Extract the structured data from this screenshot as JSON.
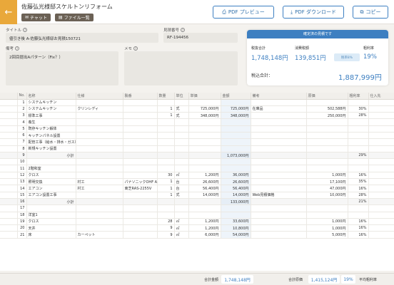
{
  "header": {
    "title": "佐藤弘光様邸スケルトンリフォーム",
    "chat_label": "チャット",
    "files_label": "ファイル一覧",
    "pdf_preview_label": "PDF プレビュー",
    "pdf_download_label": "PDF ダウンロード",
    "copy_label": "コピー"
  },
  "form": {
    "title_label": "タイトル",
    "title_value": "値引き後 A-佐藤弘光様邸お見積150721",
    "estimate_no_label": "見積番号",
    "estimate_no_value": "RF-194456",
    "notes_label": "備考",
    "notes_value": "2回目提出Aパターン（Fix？）",
    "memo_label": "メモ",
    "memo_value": ""
  },
  "summary": {
    "header": "確定済の見積です",
    "subtotal_label": "税抜合計",
    "subtotal_value": "1,748,148円",
    "tax_label": "消費税額",
    "tax_value": "139,851円",
    "tax_rate": "税率8%",
    "margin_label": "粗利率",
    "margin_value": "19%",
    "total_label": "税込合計：",
    "total_value": "1,887,999円"
  },
  "table": {
    "columns": [
      "No.",
      "名称",
      "仕様",
      "製番",
      "数量",
      "単位",
      "単価",
      "金額",
      "備考",
      "原価",
      "粗利率",
      "仕入先"
    ],
    "rows": [
      {
        "no": "1",
        "name": "システムキッチン",
        "spec": "",
        "model": "",
        "qty": "",
        "unit": "",
        "price": "",
        "amount": "",
        "note": "",
        "cost": "",
        "margin": "",
        "supplier": "",
        "sub": false
      },
      {
        "no": "2",
        "name": "システムキッチン",
        "spec": "クリンレディ",
        "model": "",
        "qty": "1",
        "unit": "式",
        "price": "725,000円",
        "amount": "725,000円",
        "note": "在庫品",
        "cost": "502,588円",
        "margin": "30%",
        "supplier": "",
        "sub": false
      },
      {
        "no": "3",
        "name": "標準工事",
        "spec": "",
        "model": "",
        "qty": "1",
        "unit": "式",
        "price": "348,000円",
        "amount": "348,000円",
        "note": "",
        "cost": "250,000円",
        "margin": "28%",
        "supplier": "",
        "sub": false
      },
      {
        "no": "4",
        "name": "養生",
        "spec": "",
        "model": "",
        "qty": "",
        "unit": "",
        "price": "",
        "amount": "",
        "note": "",
        "cost": "",
        "margin": "",
        "supplier": "",
        "sub": false
      },
      {
        "no": "5",
        "name": "既存キッチン解体",
        "spec": "",
        "model": "",
        "qty": "",
        "unit": "",
        "price": "",
        "amount": "",
        "note": "",
        "cost": "",
        "margin": "",
        "supplier": "",
        "sub": false
      },
      {
        "no": "6",
        "name": "キッチンパネル設置",
        "spec": "",
        "model": "",
        "qty": "",
        "unit": "",
        "price": "",
        "amount": "",
        "note": "",
        "cost": "",
        "margin": "",
        "supplier": "",
        "sub": false
      },
      {
        "no": "7",
        "name": "配管工事（給水・排水・ガス）",
        "spec": "",
        "model": "",
        "qty": "",
        "unit": "",
        "price": "",
        "amount": "",
        "note": "",
        "cost": "",
        "margin": "",
        "supplier": "",
        "sub": false
      },
      {
        "no": "8",
        "name": "新規キッチン設置",
        "spec": "",
        "model": "",
        "qty": "",
        "unit": "",
        "price": "",
        "amount": "",
        "note": "",
        "cost": "",
        "margin": "",
        "supplier": "",
        "sub": false
      },
      {
        "no": "9",
        "name": "小計",
        "spec": "",
        "model": "",
        "qty": "",
        "unit": "",
        "price": "",
        "amount": "1,073,000円",
        "note": "",
        "cost": "",
        "margin": "29%",
        "supplier": "",
        "sub": true
      },
      {
        "no": "10",
        "name": "",
        "spec": "",
        "model": "",
        "qty": "",
        "unit": "",
        "price": "",
        "amount": "",
        "note": "",
        "cost": "",
        "margin": "",
        "supplier": "",
        "sub": false
      },
      {
        "no": "11",
        "name": "2階和室",
        "spec": "",
        "model": "",
        "qty": "",
        "unit": "",
        "price": "",
        "amount": "",
        "note": "",
        "cost": "",
        "margin": "",
        "supplier": "",
        "sub": false
      },
      {
        "no": "12",
        "name": "クロス",
        "spec": "",
        "model": "",
        "qty": "30",
        "unit": "㎡",
        "price": "1,200円",
        "amount": "36,000円",
        "note": "",
        "cost": "1,000円",
        "margin": "16%",
        "supplier": "",
        "sub": false
      },
      {
        "no": "13",
        "name": "照明交換",
        "spec": "村工",
        "model": "パナソニックOHF A6570",
        "qty": "1",
        "unit": "台",
        "price": "26,600円",
        "amount": "26,600円",
        "note": "",
        "cost": "17,100円",
        "margin": "35%",
        "supplier": "",
        "sub": false
      },
      {
        "no": "14",
        "name": "エアコン",
        "spec": "村工",
        "model": "東芝RAS-2255V",
        "qty": "1",
        "unit": "台",
        "price": "56,400円",
        "amount": "56,400円",
        "note": "",
        "cost": "47,000円",
        "margin": "16%",
        "supplier": "",
        "sub": false
      },
      {
        "no": "15",
        "name": "エアコン設置工事",
        "spec": "",
        "model": "",
        "qty": "1",
        "unit": "式",
        "price": "14,000円",
        "amount": "14,000円",
        "note": "Web見積価格",
        "cost": "10,000円",
        "margin": "28%",
        "supplier": "",
        "sub": false
      },
      {
        "no": "16",
        "name": "小計",
        "spec": "",
        "model": "",
        "qty": "",
        "unit": "",
        "price": "",
        "amount": "133,000円",
        "note": "",
        "cost": "",
        "margin": "21%",
        "supplier": "",
        "sub": true
      },
      {
        "no": "17",
        "name": "",
        "spec": "",
        "model": "",
        "qty": "",
        "unit": "",
        "price": "",
        "amount": "",
        "note": "",
        "cost": "",
        "margin": "",
        "supplier": "",
        "sub": false
      },
      {
        "no": "18",
        "name": "洋室1",
        "spec": "",
        "model": "",
        "qty": "",
        "unit": "",
        "price": "",
        "amount": "",
        "note": "",
        "cost": "",
        "margin": "",
        "supplier": "",
        "sub": false
      },
      {
        "no": "19",
        "name": "クロス",
        "spec": "",
        "model": "",
        "qty": "28",
        "unit": "㎡",
        "price": "1,200円",
        "amount": "33,600円",
        "note": "",
        "cost": "1,000円",
        "margin": "16%",
        "supplier": "",
        "sub": false
      },
      {
        "no": "20",
        "name": "天井",
        "spec": "",
        "model": "",
        "qty": "9",
        "unit": "㎡",
        "price": "1,200円",
        "amount": "10,800円",
        "note": "",
        "cost": "1,000円",
        "margin": "16%",
        "supplier": "",
        "sub": false
      },
      {
        "no": "21",
        "name": "床",
        "spec": "カーペット",
        "model": "",
        "qty": "9",
        "unit": "㎡",
        "price": "6,000円",
        "amount": "54,000円",
        "note": "",
        "cost": "5,000円",
        "margin": "16%",
        "supplier": "",
        "sub": false
      }
    ]
  },
  "footer": {
    "total_amount_label": "合計金額",
    "total_amount_value": "1,748,148円",
    "total_cost_label": "合計原価",
    "total_cost_value": "1,415,124円",
    "margin_value": "19%",
    "avg_margin_label": "平均粗利率"
  },
  "colors": {
    "accent": "#3d7fc1",
    "back_button": "#e9a83a",
    "dark_button": "#6b6155"
  }
}
